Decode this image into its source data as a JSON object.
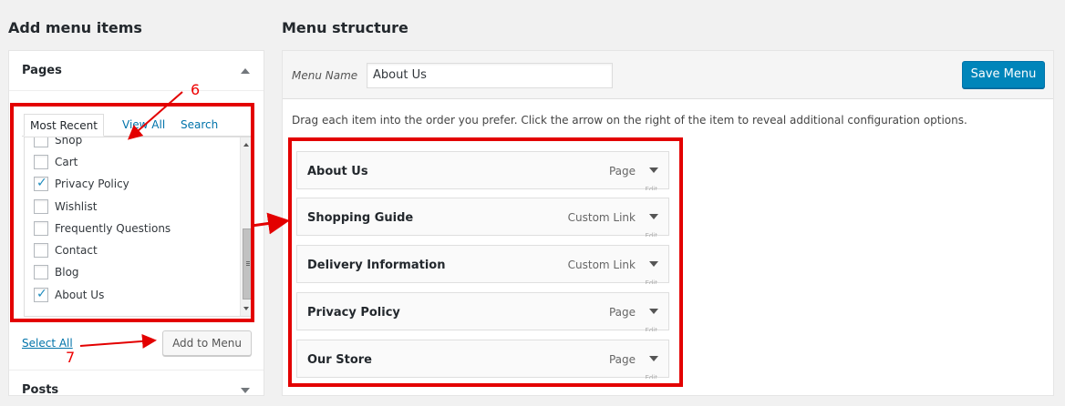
{
  "left": {
    "heading": "Add menu items",
    "section": "Pages",
    "tabs": [
      "Most Recent",
      "View All",
      "Search"
    ],
    "items": [
      {
        "label": "Shop",
        "checked": false
      },
      {
        "label": "Cart",
        "checked": false
      },
      {
        "label": "Privacy Policy",
        "checked": true
      },
      {
        "label": "Wishlist",
        "checked": false
      },
      {
        "label": "Frequently Questions",
        "checked": false
      },
      {
        "label": "Contact",
        "checked": false
      },
      {
        "label": "Blog",
        "checked": false
      },
      {
        "label": "About Us",
        "checked": true
      }
    ],
    "select_all": "Select All",
    "add_button": "Add to Menu",
    "next_section": "Posts"
  },
  "right": {
    "heading": "Menu structure",
    "menu_name_label": "Menu Name",
    "menu_name_value": "About Us",
    "save_button": "Save Menu",
    "instructions": "Drag each item into the order you prefer. Click the arrow on the right of the item to reveal additional configuration options.",
    "items": [
      {
        "title": "About Us",
        "type": "Page"
      },
      {
        "title": "Shopping Guide",
        "type": "Custom Link"
      },
      {
        "title": "Delivery Information",
        "type": "Custom Link"
      },
      {
        "title": "Privacy Policy",
        "type": "Page"
      },
      {
        "title": "Our Store",
        "type": "Page"
      }
    ],
    "edit_label": "Edit"
  },
  "annotations": {
    "step1": "6",
    "step2": "7",
    "color": "#e30000"
  },
  "colors": {
    "primary": "#0085ba",
    "link": "#0073aa",
    "checkmark": "#1e8cbe"
  }
}
